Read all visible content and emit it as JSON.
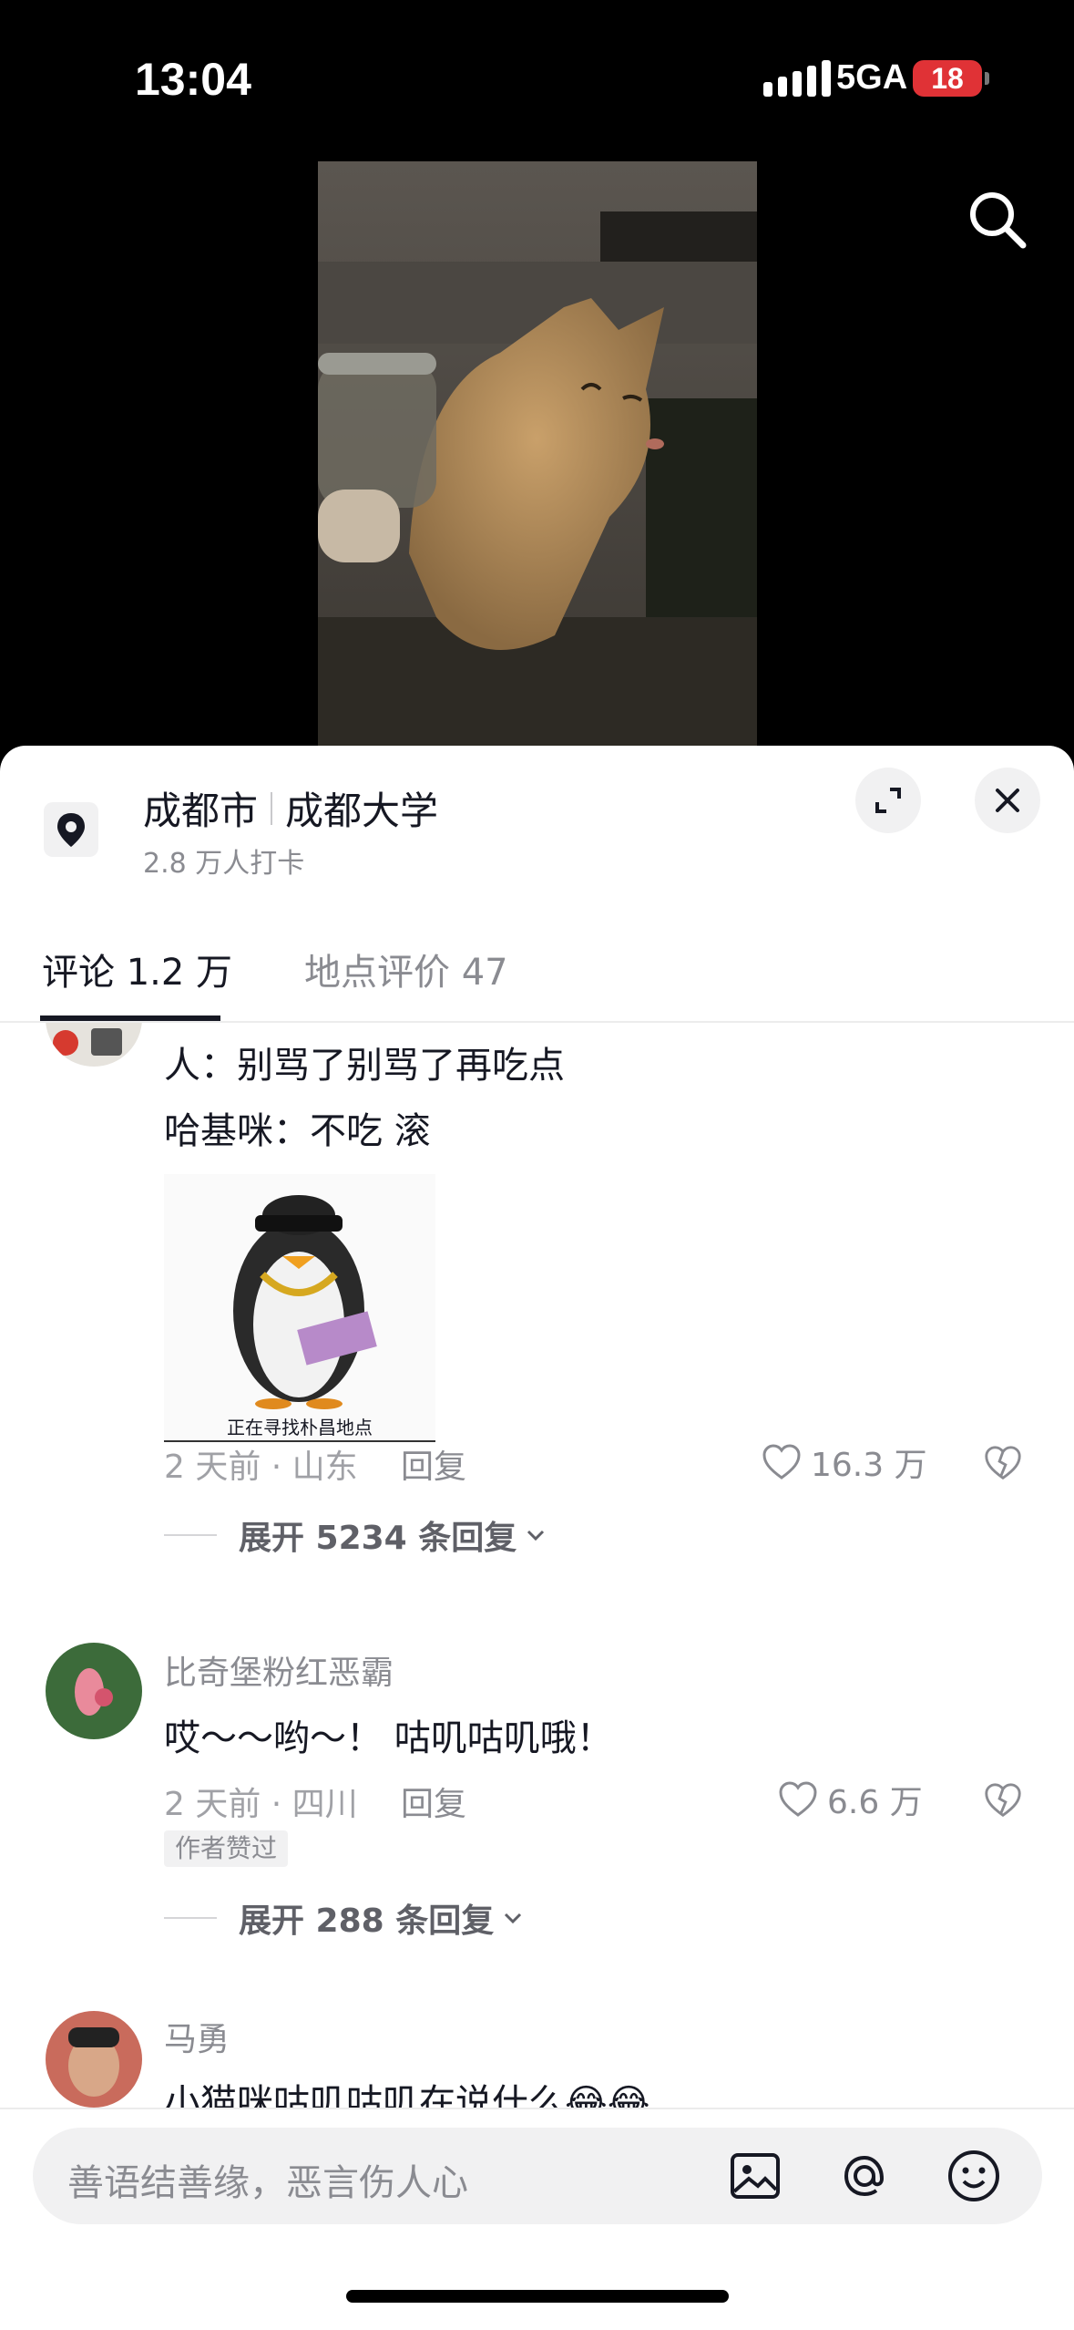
{
  "status": {
    "time": "13:04",
    "network": "5GA",
    "battery": "18"
  },
  "icons": {
    "search": "search-icon",
    "location": "location-pin-icon",
    "expand": "expand-icon",
    "close": "close-icon",
    "like": "heart-icon",
    "dislike": "broken-heart-icon",
    "image": "image-icon",
    "mention": "at-icon",
    "emoji": "emoji-icon"
  },
  "location": {
    "city": "成都市",
    "place": "成都大学",
    "checkins": "2.8 万人打卡"
  },
  "tabs": [
    {
      "label": "评论 1.2 万",
      "active": true
    },
    {
      "label": "地点评价 47",
      "active": false
    }
  ],
  "comments": [
    {
      "lines": [
        "人：别骂了别骂了再吃点",
        "哈基咪：不吃 滚"
      ],
      "sticker_caption": "正在寻找朴昌地点",
      "meta": "2 天前 · 山东",
      "reply": "回复",
      "likes": "16.3 万",
      "expand": "展开 5234 条回复"
    },
    {
      "user": "比奇堡粉红恶霸",
      "text": "哎～～哟～！ 咕叽咕叽哦！",
      "meta": "2 天前 · 四川",
      "reply": "回复",
      "likes": "6.6 万",
      "badge": "作者赞过",
      "expand": "展开 288 条回复"
    },
    {
      "user": "马勇",
      "text": "小猫咪咕叽咕叽在说什么😂😂"
    }
  ],
  "input": {
    "placeholder": "善语结善缘，恶言伤人心"
  },
  "colors": {
    "accent": "#161823",
    "muted": "#8a8b91",
    "battery": "#e03236"
  }
}
